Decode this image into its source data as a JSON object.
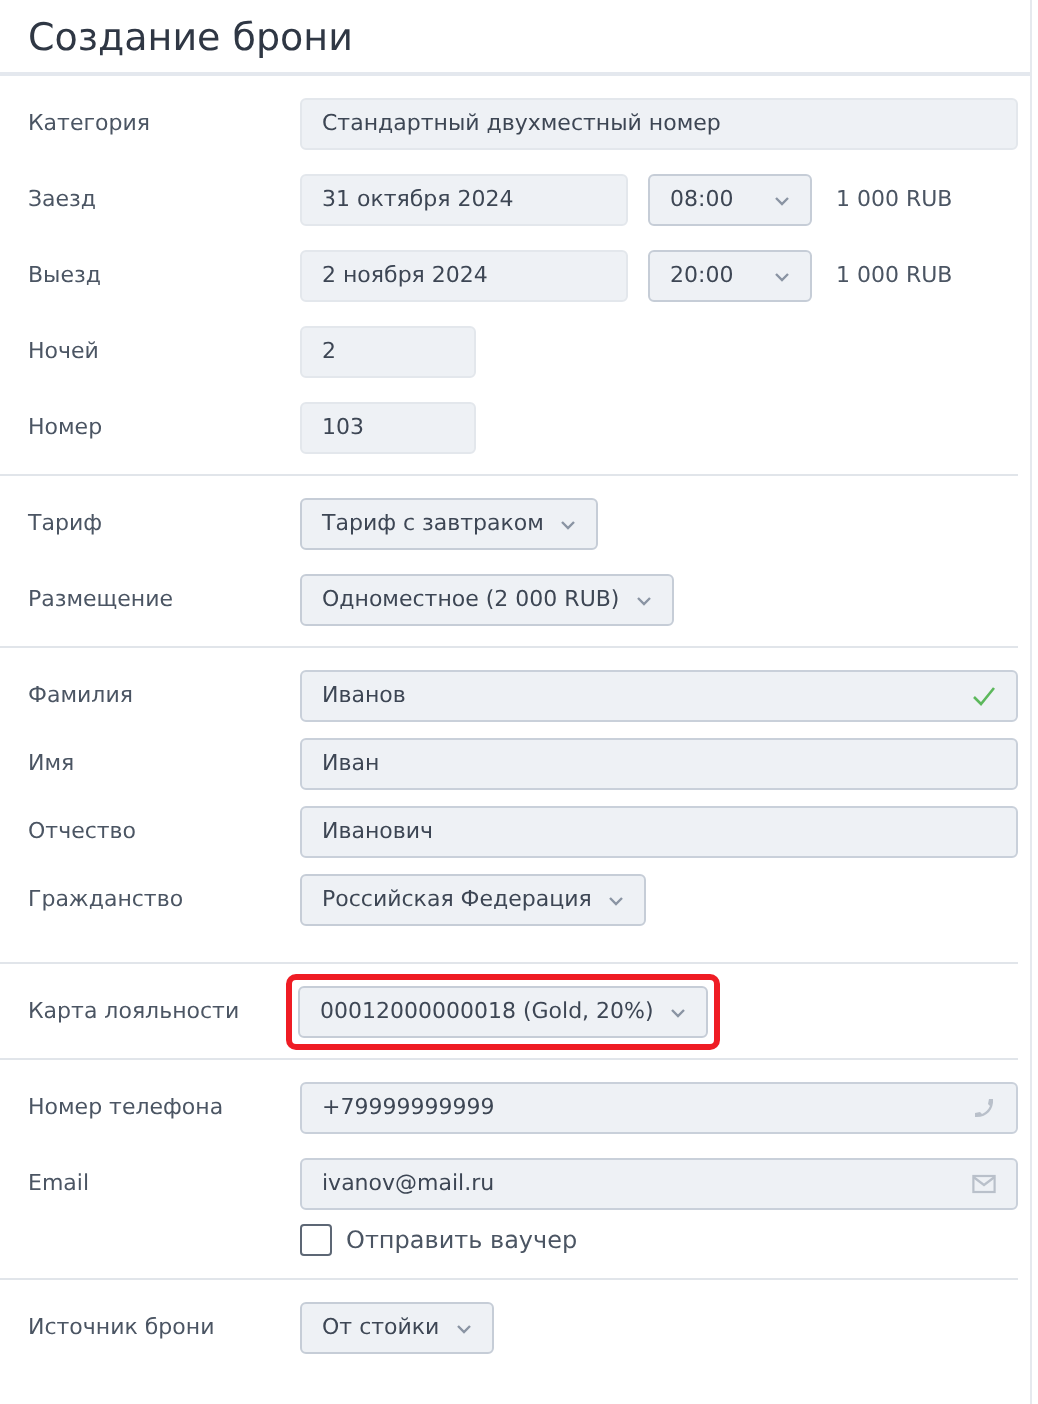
{
  "title": "Создание брони",
  "sections": [
    {
      "rows": [
        {
          "label": "Категория",
          "kind": "text",
          "value": "Стандартный двухместный номер"
        },
        {
          "label": "Заезд",
          "kind": "datetime",
          "date": "31 октября 2024",
          "time": "08:00",
          "price": "1 000 RUB"
        },
        {
          "label": "Выезд",
          "kind": "datetime",
          "date": "2 ноября 2024",
          "time": "20:00",
          "price": "1 000 RUB"
        },
        {
          "label": "Ночей",
          "kind": "short",
          "value": "2"
        },
        {
          "label": "Номер",
          "kind": "short",
          "value": "103"
        }
      ]
    },
    {
      "rows": [
        {
          "label": "Тариф",
          "kind": "select",
          "value": "Тариф с завтраком"
        },
        {
          "label": "Размещение",
          "kind": "select",
          "value": "Одноместное (2 000 RUB)"
        }
      ]
    },
    {
      "rows": [
        {
          "label": "Фамилия",
          "kind": "input",
          "value": "Иванов",
          "valid": true
        },
        {
          "label": "Имя",
          "kind": "input",
          "value": "Иван",
          "valid": false
        },
        {
          "label": "Отчество",
          "kind": "input",
          "value": "Иванович",
          "valid": false
        },
        {
          "label": "Гражданство",
          "kind": "select",
          "value": "Российская Федерация"
        }
      ]
    },
    {
      "rows": [
        {
          "label": "Карта лояльности",
          "kind": "select",
          "value": "00012000000018 (Gold, 20%)",
          "highlighted": true
        }
      ]
    },
    {
      "rows": [
        {
          "label": "Номер телефона",
          "kind": "phone",
          "value": "+79999999999"
        },
        {
          "label": "Email",
          "kind": "email",
          "value": "ivanov@mail.ru",
          "checkbox": {
            "label": "Отправить ваучер",
            "checked": false
          }
        }
      ]
    },
    {
      "rows": [
        {
          "label": "Источник брони",
          "kind": "select",
          "value": "От стойки"
        }
      ]
    }
  ]
}
